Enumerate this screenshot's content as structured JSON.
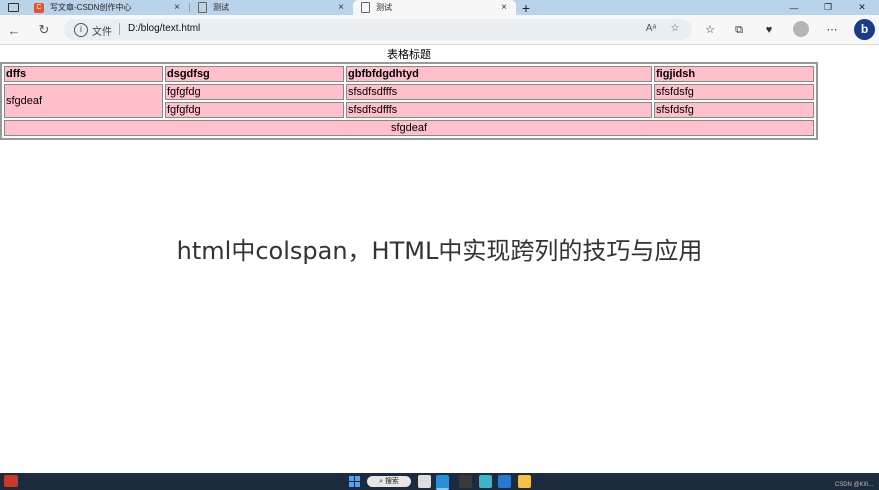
{
  "tabs": [
    {
      "title": "写文章-CSDN创作中心",
      "active": false,
      "favicon": "csdn-logo",
      "favicon_text": "C"
    },
    {
      "title": "测试",
      "active": false,
      "favicon": "page-icon"
    },
    {
      "title": "测试",
      "active": true,
      "favicon": "page-icon"
    }
  ],
  "tab_close_glyph": "×",
  "new_tab_glyph": "+",
  "window_controls": {
    "minimize": "—",
    "restore": "❐",
    "close": "✕"
  },
  "address": {
    "scheme_label": "文件",
    "url": "D:/blog/text.html"
  },
  "table": {
    "caption": "表格标题",
    "headers": [
      "dffs",
      "dsgdfsg",
      "gbfbfdgdhtyd",
      "figjidsh"
    ],
    "rowspan_cell": "sfgdeaf",
    "rows": [
      [
        "fgfgfdg",
        "sfsdfsdfffs",
        "sfsfdsfg"
      ],
      [
        "fgfgfdg",
        "sfsdfsdfffs",
        "sfsfdsfg"
      ]
    ],
    "footer": "sfgdeaf",
    "cell_background": "#ffc0cb"
  },
  "overlay_title": "html中colspan，HTML中实现跨列的技巧与应用",
  "taskbar": {
    "search_label": "搜索",
    "watermark": "CSDN @Kifi..."
  }
}
